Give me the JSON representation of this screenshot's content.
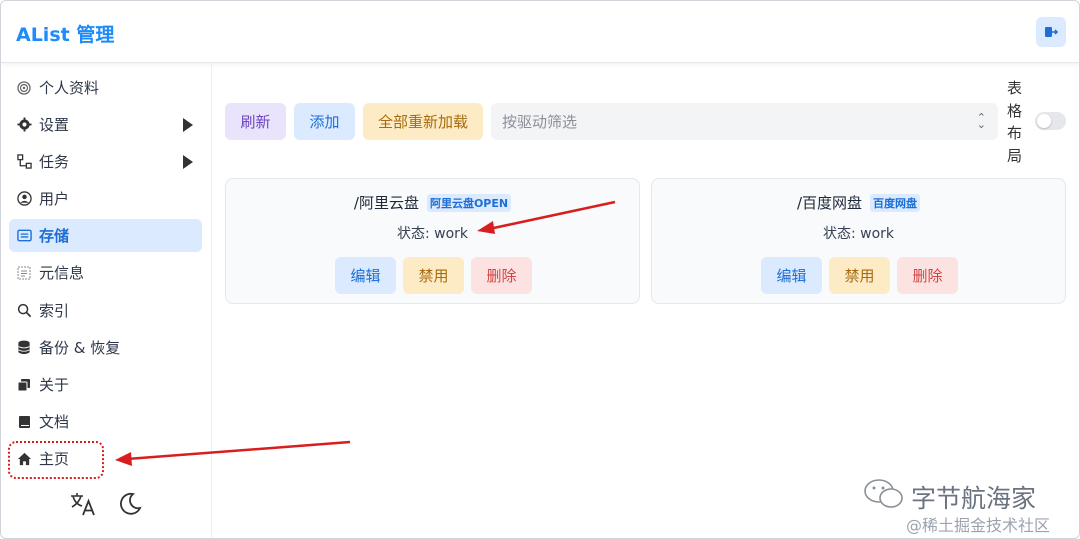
{
  "header": {
    "title": "AList 管理"
  },
  "sidebar": {
    "items": [
      {
        "label": "个人资料",
        "icon": "fingerprint-icon"
      },
      {
        "label": "设置",
        "icon": "gear-icon",
        "has_children": true
      },
      {
        "label": "任务",
        "icon": "workflow-icon",
        "has_children": true
      },
      {
        "label": "用户",
        "icon": "user-circle-icon"
      },
      {
        "label": "存储",
        "icon": "storage-icon",
        "active": true
      },
      {
        "label": "元信息",
        "icon": "meta-icon"
      },
      {
        "label": "索引",
        "icon": "search-icon"
      },
      {
        "label": "备份 & 恢复",
        "icon": "database-icon"
      },
      {
        "label": "关于",
        "icon": "copy-icon"
      },
      {
        "label": "文档",
        "icon": "book-icon"
      },
      {
        "label": "主页",
        "icon": "home-icon"
      }
    ]
  },
  "toolbar": {
    "refresh": "刷新",
    "add": "添加",
    "reload_all": "全部重新加载",
    "filter_placeholder": "按驱动筛选",
    "layout_label": "表格布局"
  },
  "cards": [
    {
      "path": "/阿里云盘",
      "badge": "阿里云盘OPEN",
      "status": "状态: work",
      "edit": "编辑",
      "disable": "禁用",
      "delete": "删除"
    },
    {
      "path": "/百度网盘",
      "badge": "百度网盘",
      "status": "状态: work",
      "edit": "编辑",
      "disable": "禁用",
      "delete": "删除"
    }
  ],
  "watermark": {
    "brand": "字节航海家",
    "site": "@稀土掘金技术社区"
  },
  "colors": {
    "accent": "#1d8cf8",
    "annotation": "#d81e1e"
  }
}
